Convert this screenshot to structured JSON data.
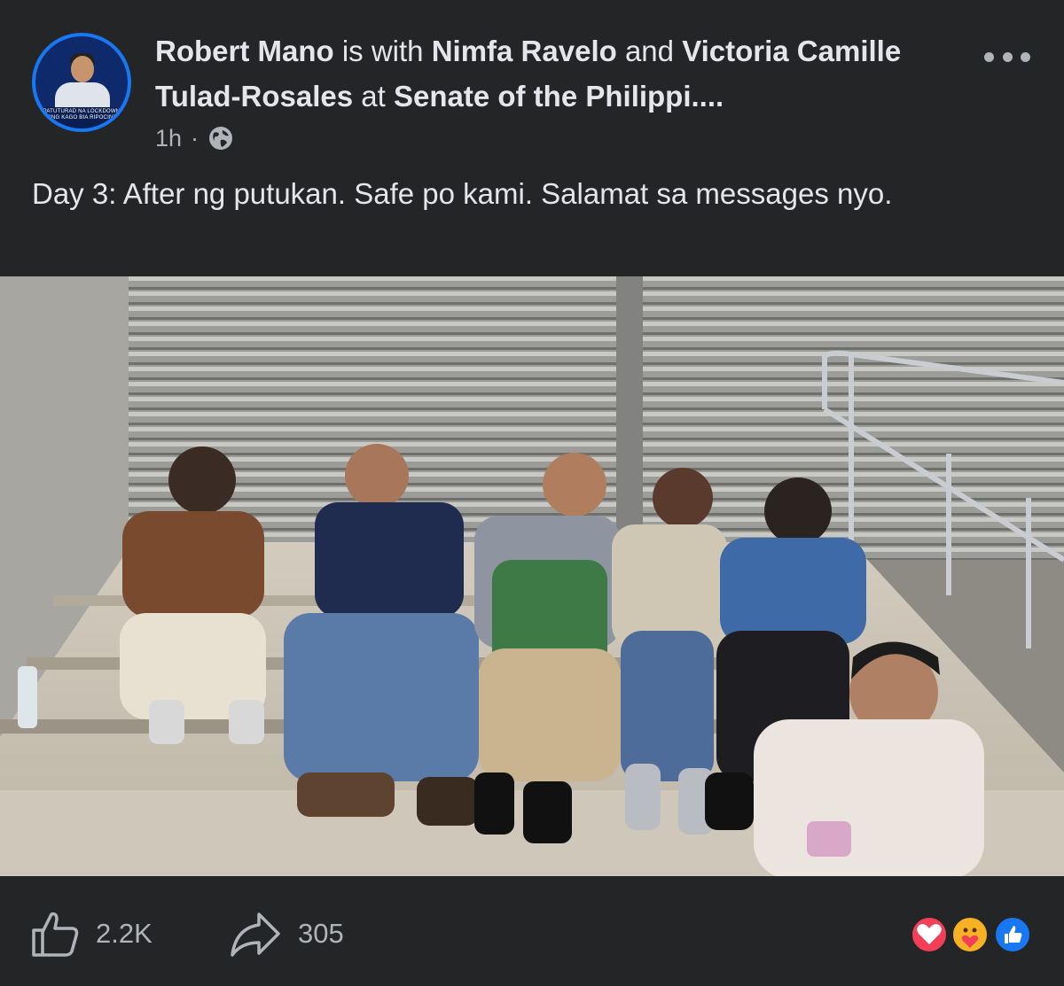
{
  "post": {
    "author": "Robert Mano",
    "with_text": "is with",
    "tagged_1": "Nimfa Ravelo",
    "and_text": "and",
    "tagged_2": "Victoria Camille Tulad-Rosales",
    "at_text": "at",
    "location": "Senate of the Philippi....",
    "timestamp": "1h",
    "separator": "·",
    "privacy_icon": "globe-icon",
    "caption": "Day 3: After ng putukan. Safe po kami. Salamat sa messages nyo.",
    "avatar_banner": "PATUTURAD NA LOCKDOWN TING KAGO BIA RIPOCINE"
  },
  "actions": {
    "like_count": "2.2K",
    "share_count": "305",
    "like_icon": "thumbs-up-icon",
    "share_icon": "share-arrow-icon",
    "more_icon": "more-options-icon"
  },
  "reactions": [
    "love",
    "care",
    "like"
  ],
  "colors": {
    "background": "#242526",
    "text": "#e4e6eb",
    "secondary_text": "#b0b3b8",
    "accent": "#1877f2",
    "love": "#f33e58",
    "care": "#f7b125"
  }
}
